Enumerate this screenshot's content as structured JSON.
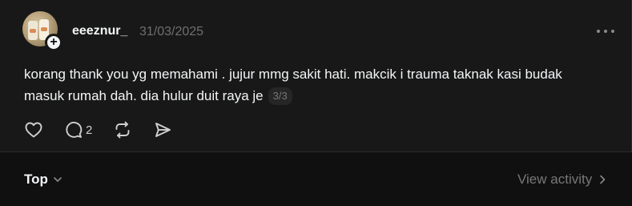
{
  "post": {
    "username": "eeeznur_",
    "timestamp": "31/03/2025",
    "text": "korang thank you yg memahami . jujur mmg sakit hati. makcik i trauma taknak kasi budak masuk rumah dah. dia hulur duit raya je",
    "page_indicator": "3/3",
    "follow_symbol": "+",
    "reply_count": "2",
    "icons": {
      "more": "more-horizontal-icon",
      "like": "heart-icon",
      "reply": "comment-icon",
      "repost": "repost-icon",
      "share": "send-icon"
    }
  },
  "footer": {
    "sort_label": "Top",
    "view_activity_label": "View activity"
  },
  "colors": {
    "background": "#101010",
    "card": "#181818",
    "text": "#f3f5f7",
    "muted": "#777777"
  }
}
